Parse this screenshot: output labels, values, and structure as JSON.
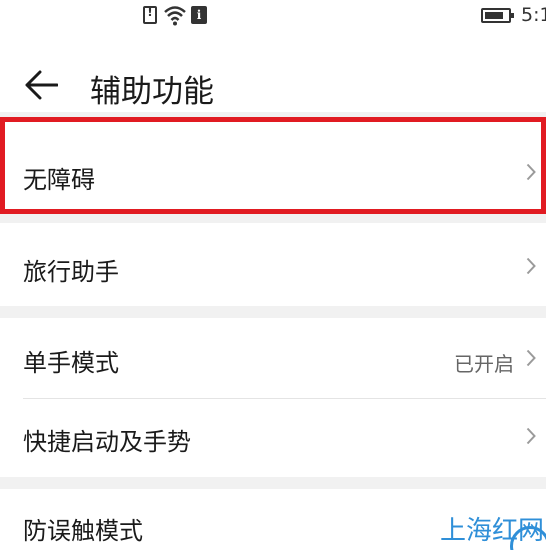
{
  "status_bar": {
    "time": "5:1",
    "icons": [
      "alert-icon",
      "wifi-icon",
      "info-icon",
      "battery-charging-icon"
    ]
  },
  "header": {
    "title": "辅助功能",
    "back_icon": "arrow-left-icon"
  },
  "items": [
    {
      "label": "无障碍",
      "highlighted": true,
      "highlight_color": "#e11b22"
    },
    {
      "label": "旅行助手"
    },
    {
      "label": "单手模式",
      "value": "已开启"
    },
    {
      "label": "快捷启动及手势"
    },
    {
      "label": "防误触模式"
    }
  ],
  "watermark": {
    "text": "上海红网",
    "color": "#2f8fd8"
  }
}
